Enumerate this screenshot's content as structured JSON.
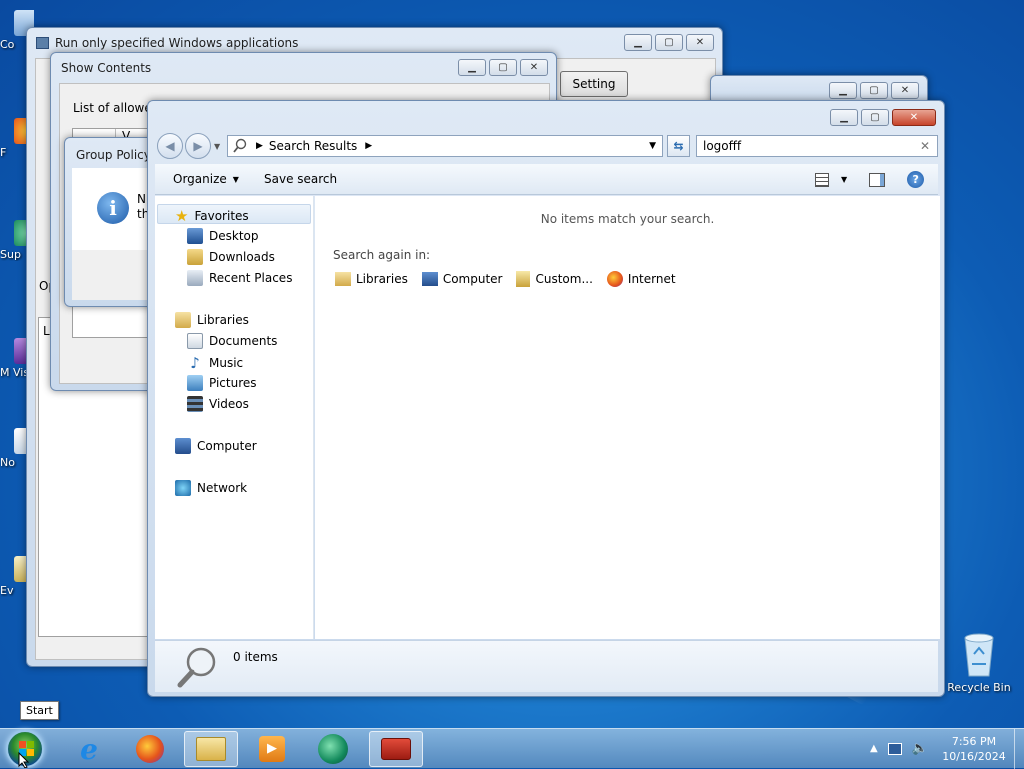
{
  "desktop": {
    "icons": [
      {
        "label": "Co"
      },
      {
        "label": "F"
      },
      {
        "label": "Sup"
      },
      {
        "label": "M Visu"
      },
      {
        "label": "No"
      },
      {
        "label": "Ev"
      }
    ],
    "recycle_bin": "Recycle Bin"
  },
  "win_run_only": {
    "title": "Run only specified Windows applications",
    "setting_button": "Setting",
    "option_label": "Op",
    "list_label": "Li"
  },
  "win_show_contents": {
    "title": "Show Contents",
    "list_label": "List of allowed",
    "cell_value": "V"
  },
  "win_group_policy": {
    "title": "Group Policy",
    "message_line1": "N",
    "message_line2": "th"
  },
  "explorer": {
    "breadcrumb": "Search Results",
    "search_value": "logofff",
    "toolbar": {
      "organize": "Organize",
      "save_search": "Save search"
    },
    "nav": {
      "favorites": "Favorites",
      "desktop": "Desktop",
      "downloads": "Downloads",
      "recent_places": "Recent Places",
      "libraries": "Libraries",
      "documents": "Documents",
      "music": "Music",
      "pictures": "Pictures",
      "videos": "Videos",
      "computer": "Computer",
      "network": "Network"
    },
    "no_items_message": "No items match your search.",
    "search_again_label": "Search again in:",
    "search_again_options": [
      "Libraries",
      "Computer",
      "Custom...",
      "Internet"
    ],
    "status_count": "0 items"
  },
  "start_tooltip": "Start",
  "clock": {
    "time": "7:56 PM",
    "date": "10/16/2024"
  },
  "colors": {
    "accent": "#1f7fd0",
    "close_button": "#c7442a"
  }
}
